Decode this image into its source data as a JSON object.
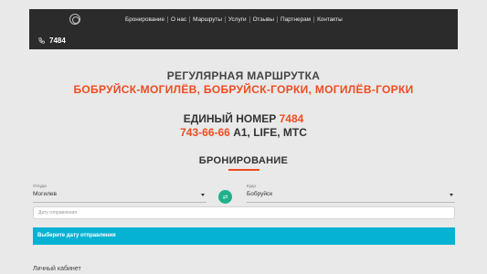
{
  "header": {
    "nav": [
      {
        "label": "Бронирование"
      },
      {
        "label": "О нас"
      },
      {
        "label": "Маршруты"
      },
      {
        "label": "Услуги"
      },
      {
        "label": "Отзывы"
      },
      {
        "label": "Партнерам"
      },
      {
        "label": "Контакты"
      }
    ],
    "phone": "7484"
  },
  "hero": {
    "title": "РЕГУЛЯРНАЯ МАРШРУТКА",
    "routes": "БОБРУЙСК-МОГИЛЁВ, БОБРУЙСК-ГОРКИ, МОГИЛЁВ-ГОРКИ",
    "number_label": "ЕДИНЫЙ НОМЕР",
    "number_short": "7484",
    "number_full": "743-66-66",
    "operators": "А1, LIFE, МТС"
  },
  "booking": {
    "title": "БРОНИРОВАНИЕ",
    "from_label": "Откуда",
    "from_value": "Могилев",
    "to_label": "Куда",
    "to_value": "Бобруйск",
    "date_placeholder": "Дату отправления",
    "alert": "Выберите дату отправления"
  },
  "footer": {
    "cabinet": "Личный кабинет"
  },
  "colors": {
    "accent": "#ee4c22",
    "header_bg": "#2b2b2b",
    "swap_button": "#22b08a",
    "alert_bg": "#06b2d3"
  }
}
